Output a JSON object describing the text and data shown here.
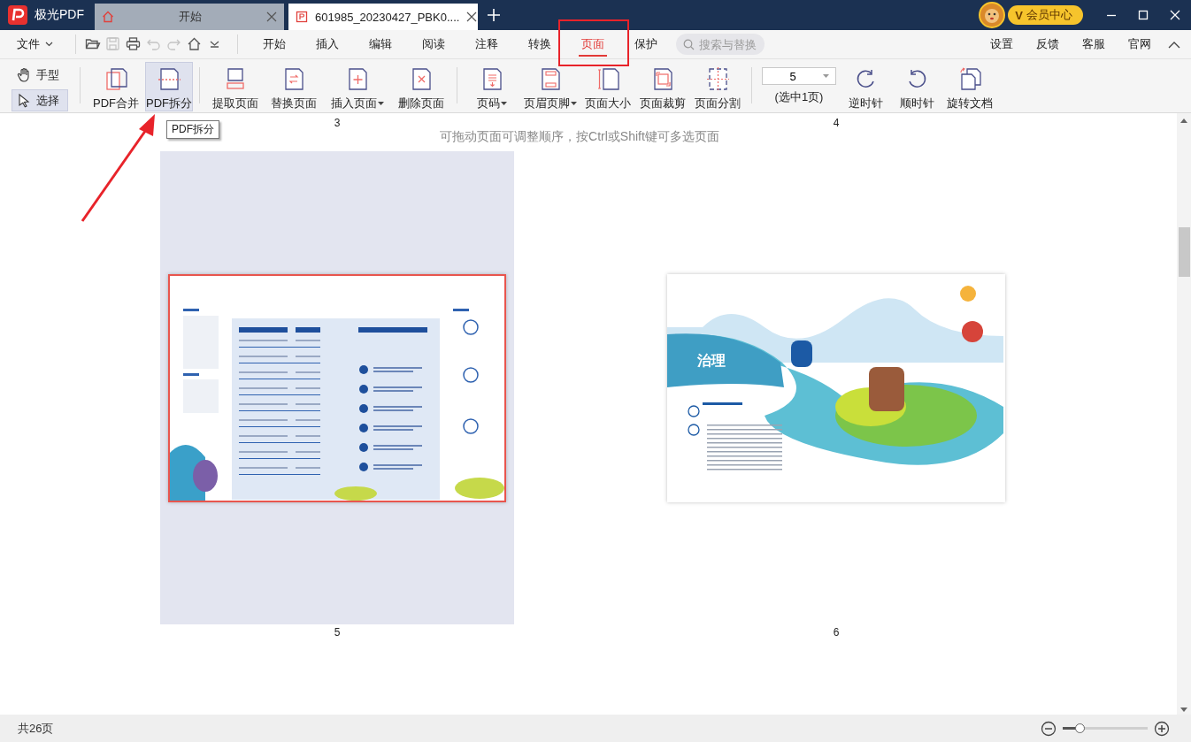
{
  "app": {
    "name": "极光PDF",
    "member_badge": "会员中心",
    "member_mark": "V"
  },
  "title_tabs": [
    {
      "label": "开始",
      "selected": false
    },
    {
      "label": "601985_20230427_PBK0....",
      "selected": true
    }
  ],
  "menu": {
    "file": "文件",
    "quick_access": [
      {
        "disabled": false
      },
      {
        "disabled": true
      },
      {
        "disabled": false
      },
      {
        "disabled": true
      },
      {
        "disabled": true
      },
      {
        "disabled": false
      },
      {
        "disabled": false
      }
    ],
    "tabs": [
      {
        "label": "开始",
        "selected": false
      },
      {
        "label": "插入",
        "selected": false
      },
      {
        "label": "编辑",
        "selected": false
      },
      {
        "label": "阅读",
        "selected": false
      },
      {
        "label": "注释",
        "selected": false
      },
      {
        "label": "转换",
        "selected": false
      },
      {
        "label": "页面",
        "selected": true
      },
      {
        "label": "保护",
        "selected": false
      }
    ],
    "search": {
      "placeholder": "搜索与替换"
    },
    "links": [
      "设置",
      "反馈",
      "客服",
      "官网"
    ]
  },
  "modes": [
    {
      "label": "手型",
      "selected": false
    },
    {
      "label": "选择",
      "selected": true
    }
  ],
  "toolbar": [
    {
      "kind": "tool",
      "label": "PDF合并",
      "dropdown": false,
      "selected": false
    },
    {
      "kind": "tool",
      "label": "PDF拆分",
      "dropdown": false,
      "selected": true
    },
    {
      "kind": "separator"
    },
    {
      "kind": "tool",
      "label": "提取页面",
      "dropdown": false,
      "selected": false
    },
    {
      "kind": "tool",
      "label": "替换页面",
      "dropdown": false,
      "selected": false
    },
    {
      "kind": "tool",
      "label": "插入页面",
      "dropdown": true,
      "selected": false
    },
    {
      "kind": "tool",
      "label": "删除页面",
      "dropdown": false,
      "selected": false
    },
    {
      "kind": "separator"
    },
    {
      "kind": "tool",
      "label": "页码",
      "dropdown": true,
      "selected": false
    },
    {
      "kind": "tool",
      "label": "页眉页脚",
      "dropdown": true,
      "selected": false
    },
    {
      "kind": "tool",
      "label": "页面大小",
      "dropdown": false,
      "selected": false
    },
    {
      "kind": "tool",
      "label": "页面裁剪",
      "dropdown": false,
      "selected": false
    },
    {
      "kind": "tool",
      "label": "页面分割",
      "dropdown": false,
      "selected": false
    },
    {
      "kind": "separator"
    },
    {
      "kind": "pagebox",
      "value": "5",
      "caption": "(选中1页)"
    },
    {
      "kind": "tool",
      "label": "逆时针",
      "dropdown": false,
      "selected": false
    },
    {
      "kind": "tool",
      "label": "顺时针",
      "dropdown": false,
      "selected": false
    },
    {
      "kind": "tool",
      "label": "旋转文档",
      "dropdown": false,
      "selected": false
    }
  ],
  "tooltip": "PDF拆分",
  "pages_view": {
    "hint": "可拖动页面可调整顺序，按Ctrl或Shift键可多选页面",
    "previous_row_labels": [
      "3",
      "4"
    ],
    "pages": [
      {
        "label": "5",
        "selected": true,
        "kind": "strategy"
      },
      {
        "label": "6",
        "selected": false,
        "kind": "governance",
        "heading": "治理"
      }
    ]
  },
  "status_bar": {
    "page_count": "共26页",
    "zoom": {
      "level": 0.2
    }
  }
}
